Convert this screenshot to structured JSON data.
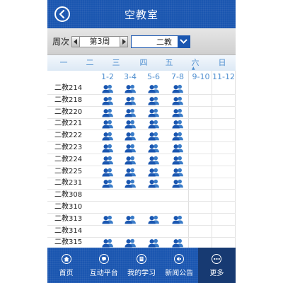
{
  "navbar": {
    "title": "空教室"
  },
  "filter": {
    "week_label": "周次",
    "week_value": "第3周",
    "building_value": "二教"
  },
  "days": [
    "一",
    "二",
    "三",
    "四",
    "五",
    "六",
    "日"
  ],
  "slots": [
    "1-2",
    "3-4",
    "5-6",
    "7-8",
    "9-10",
    "11-12"
  ],
  "rooms": [
    {
      "name": "二教214",
      "free": [
        true,
        true,
        true,
        true,
        false,
        false
      ]
    },
    {
      "name": "二教218",
      "free": [
        true,
        true,
        true,
        true,
        false,
        false
      ]
    },
    {
      "name": "二教220",
      "free": [
        true,
        true,
        true,
        true,
        false,
        false
      ]
    },
    {
      "name": "二教221",
      "free": [
        true,
        true,
        true,
        true,
        false,
        false
      ]
    },
    {
      "name": "二教222",
      "free": [
        true,
        true,
        true,
        true,
        false,
        false
      ]
    },
    {
      "name": "二教223",
      "free": [
        true,
        true,
        true,
        true,
        false,
        false
      ]
    },
    {
      "name": "二教224",
      "free": [
        true,
        true,
        true,
        true,
        false,
        false
      ]
    },
    {
      "name": "二教225",
      "free": [
        true,
        true,
        true,
        true,
        false,
        false
      ]
    },
    {
      "name": "二教231",
      "free": [
        true,
        true,
        true,
        true,
        false,
        false
      ]
    },
    {
      "name": "二教308",
      "free": [
        false,
        false,
        false,
        false,
        false,
        false
      ]
    },
    {
      "name": "二教310",
      "free": [
        false,
        false,
        false,
        false,
        false,
        false
      ]
    },
    {
      "name": "二教313",
      "free": [
        true,
        true,
        true,
        true,
        false,
        false
      ]
    },
    {
      "name": "二教314",
      "free": [
        false,
        false,
        false,
        false,
        false,
        false
      ]
    },
    {
      "name": "二教315",
      "free": [
        true,
        true,
        true,
        true,
        false,
        false
      ]
    }
  ],
  "tabs": [
    {
      "label": "首页",
      "icon": "home-icon"
    },
    {
      "label": "互动平台",
      "icon": "chat-icon"
    },
    {
      "label": "我的学习",
      "icon": "study-icon"
    },
    {
      "label": "新闻公告",
      "icon": "news-icon"
    },
    {
      "label": "更多",
      "icon": "more-icon",
      "active": true
    }
  ],
  "colors": {
    "primary": "#1a56b0",
    "accent": "#4f8fd0",
    "active_tab": "#173a72"
  }
}
